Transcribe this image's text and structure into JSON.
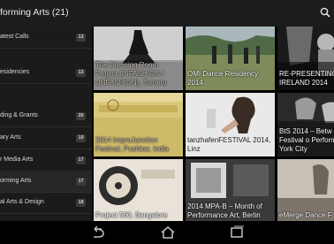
{
  "header": {
    "title": "forming Arts (21)",
    "search_icon": "search-icon"
  },
  "sidebar": {
    "items": [
      {
        "label": "atest Calls",
        "count": "13"
      },
      {
        "label": "esidencies",
        "count": "13"
      },
      {
        "label": "ding & Grants",
        "count": "20"
      },
      {
        "label": "ary Arts",
        "count": "19"
      },
      {
        "label": "r Media Arts",
        "count": "17"
      },
      {
        "label": "orming Arts",
        "count": "17"
      },
      {
        "label": "al Arts & Design",
        "count": "18"
      },
      {
        "label": "",
        "count": ""
      }
    ]
  },
  "grid": {
    "tiles": [
      {
        "caption": "The Dressing Room Project (INFASHION / UNFASHION), Toronto"
      },
      {
        "caption": "OMI Dance Residency 2014"
      },
      {
        "caption": "RE-PRESENTING IRELAND 2014"
      },
      {
        "caption": "2014 ImproJunction Festival, Pushkar, India"
      },
      {
        "caption": "tanzhafenFESTIVAL 2014, Linz"
      },
      {
        "caption": "BtS 2014 – Betw Seas Festival o Performance Ar York City"
      },
      {
        "caption": "Project 560, Bangalore"
      },
      {
        "caption": "2014 MPA-B – Month of Performance Art, Berlin"
      },
      {
        "caption": "eMerge Dance F"
      }
    ]
  },
  "navbar": {
    "back_icon": "back-icon",
    "home_icon": "home-icon",
    "recents_icon": "recents-icon"
  },
  "colors": {
    "sidebar_bg": "#1b1b1b",
    "statusbar_bg": "#1c1c1c",
    "badge_bg": "#3a3a3a"
  }
}
